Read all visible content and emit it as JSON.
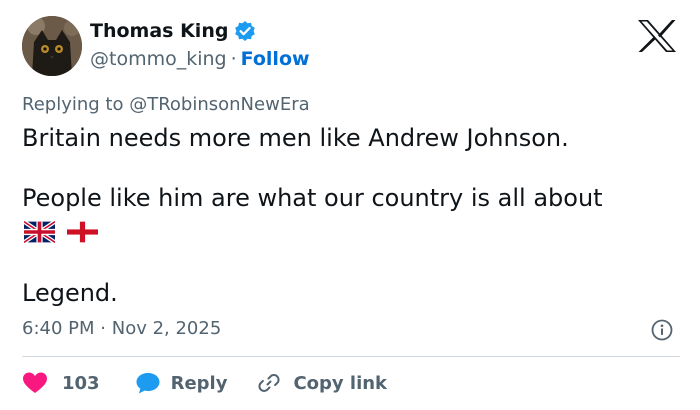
{
  "author": {
    "display_name": "Thomas King",
    "handle": "@tommo_king",
    "separator": "·",
    "follow_label": "Follow",
    "verified_icon": "verified-badge-icon",
    "avatar": "cat-avatar"
  },
  "brand_logo": "x-logo-icon",
  "reply": {
    "prefix": "Replying to",
    "target": "@TRobinsonNewEra"
  },
  "tweet": {
    "line1": "Britain needs more men like Andrew Johnson.",
    "line2": "People like him are what our country is all about",
    "emojis": [
      "uk-flag-emoji",
      "england-flag-emoji"
    ],
    "line3": "Legend."
  },
  "meta": {
    "time": "6:40 PM",
    "separator": "·",
    "date": "Nov 2, 2025",
    "info_icon": "info-icon"
  },
  "actions": {
    "like_count": "103",
    "reply_label": "Reply",
    "copy_label": "Copy link"
  },
  "colors": {
    "link_blue": "#006fd6",
    "muted_text": "#536471",
    "like_red": "#f91880",
    "reply_blue": "#1d9bf0",
    "divider": "#cfd9de",
    "verified": "#1d9bf0"
  }
}
